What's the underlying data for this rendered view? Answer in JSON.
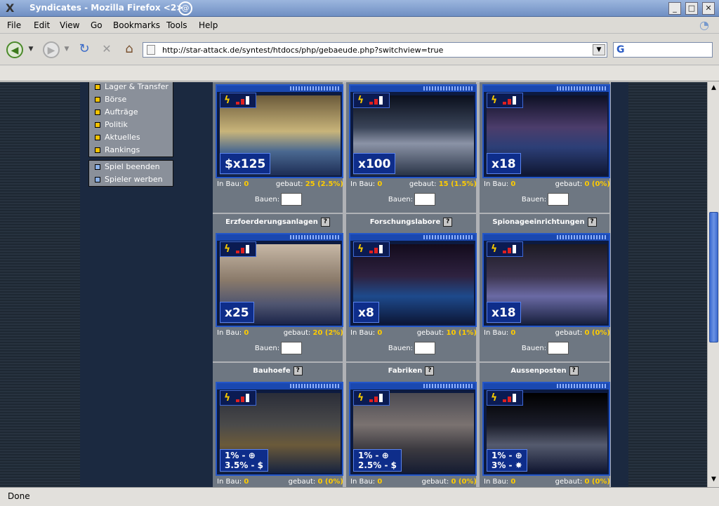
{
  "window": {
    "title": "Syndicates - Mozilla Firefox <2>",
    "title_mark": "X"
  },
  "menu": {
    "items": [
      "File",
      "Edit",
      "View",
      "Go",
      "Bookmarks",
      "Tools",
      "Help"
    ]
  },
  "nav": {
    "url": "http://star-attack.de/syntest/htdocs/php/gebaeude.php?switchview=true",
    "search_placeholder": "",
    "search_engine_glyph": "G"
  },
  "sidebar": {
    "group1": [
      "Lager & Transfer",
      "Börse",
      "Aufträge",
      "Politik",
      "Aktuelles",
      "Rankings"
    ],
    "group2": [
      "Spiel beenden",
      "Spieler werben"
    ],
    "group1_color": "#f2c200",
    "group2_color": "#8ab0e8"
  },
  "grid": {
    "labels": {
      "in_bau": "In Bau:",
      "gebaut": "gebaut:",
      "bauen": "Bauen:",
      "help": "?"
    },
    "row1": [
      {
        "title": "",
        "badge": "$x125",
        "in_bau": "0",
        "gebaut": "25 (2.5%)",
        "bars": [
          4,
          8,
          12
        ],
        "scene": "temple"
      },
      {
        "title": "",
        "badge": "x100",
        "in_bau": "0",
        "gebaut": "15 (1.5%)",
        "bars": [
          4,
          8,
          12
        ],
        "scene": "power"
      },
      {
        "title": "",
        "badge": "x18",
        "in_bau": "0",
        "gebaut": "0 (0%)",
        "bars": [
          4,
          8,
          12
        ],
        "scene": "dome"
      }
    ],
    "row2": [
      {
        "title": "Erzfoerderungsanlagen",
        "badge": "x25",
        "in_bau": "0",
        "gebaut": "20 (2%)",
        "bars": [
          4,
          8,
          12
        ],
        "scene": "mine"
      },
      {
        "title": "Forschungslabore",
        "badge": "x8",
        "in_bau": "0",
        "gebaut": "10 (1%)",
        "bars": [
          4,
          8,
          12
        ],
        "scene": "tower"
      },
      {
        "title": "Spionageeinrichtungen",
        "badge": "x18",
        "in_bau": "0",
        "gebaut": "0 (0%)",
        "bars": [
          4,
          8,
          12
        ],
        "scene": "spy"
      }
    ],
    "row3": [
      {
        "title": "Bauhoefe",
        "badge_line1": "1% - ⊕",
        "badge_line2": "3.5% - $",
        "in_bau": "0",
        "gebaut": "0 (0%)",
        "bars": [
          4,
          8,
          12
        ],
        "scene": "yard"
      },
      {
        "title": "Fabriken",
        "badge_line1": "1% - ⊕",
        "badge_line2": "2.5% - $",
        "in_bau": "0",
        "gebaut": "0 (0%)",
        "bars": [
          4,
          8,
          12
        ],
        "scene": "factory"
      },
      {
        "title": "Aussenposten",
        "badge_line1": "1% - ⊕",
        "badge_line2": "3% - ✸",
        "in_bau": "0",
        "gebaut": "0 (0%)",
        "bars": [
          4,
          8,
          12
        ],
        "scene": "outpost"
      }
    ]
  },
  "status": {
    "text": "Done"
  },
  "colors": {
    "accent": "#2356c9",
    "highlight": "#ffcc00"
  }
}
